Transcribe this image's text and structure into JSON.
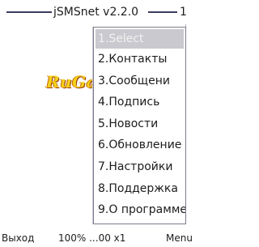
{
  "window": {
    "title": "jSMSnet v2.2.0",
    "count": "1"
  },
  "watermark": {
    "text": "RuGame.Mobi"
  },
  "menu": {
    "items": [
      {
        "label": "1.Select"
      },
      {
        "label": "2.Контакты"
      },
      {
        "label": "3.Сообщени"
      },
      {
        "label": "4.Подпись"
      },
      {
        "label": "5.Новости"
      },
      {
        "label": "6.Обновление"
      },
      {
        "label": "7.Настройки"
      },
      {
        "label": "8.Поддержка"
      },
      {
        "label": "9.О программе"
      }
    ],
    "selected_index": 0
  },
  "soft_keys": {
    "left": "Выход",
    "center": "100% ...00 x1",
    "right": "Menu"
  },
  "colors": {
    "selection": "#c9c9cf",
    "watermark": "#f5d11a",
    "title_line": "#3a3a5a"
  }
}
